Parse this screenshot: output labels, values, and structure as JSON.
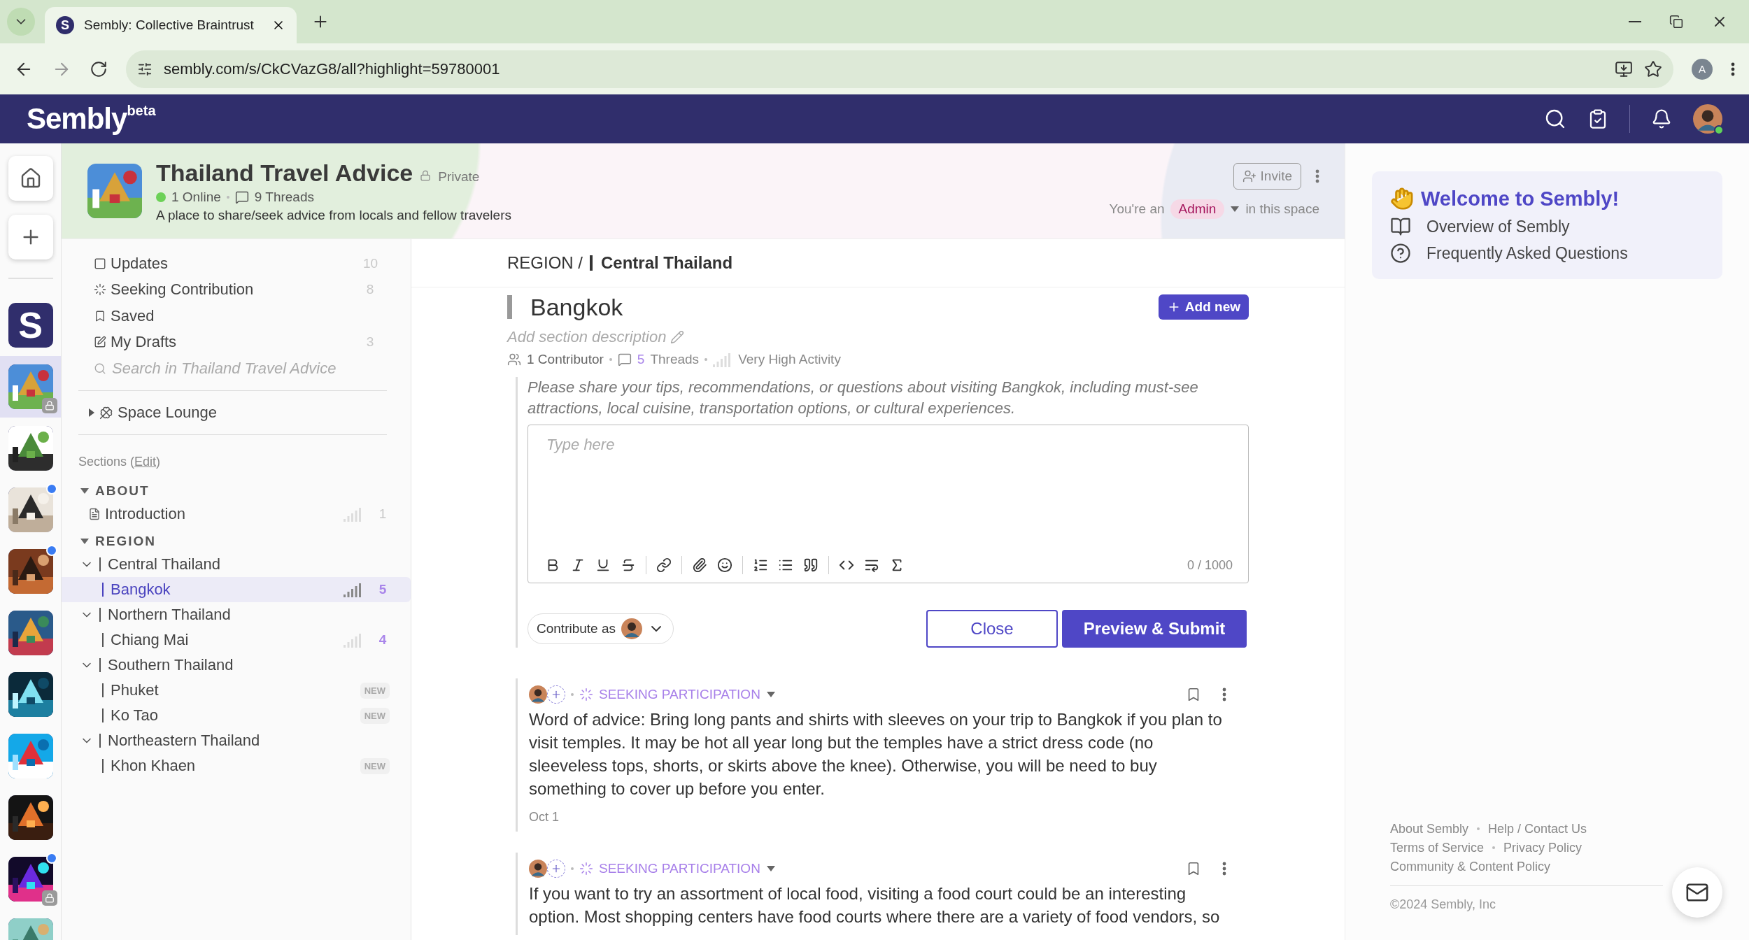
{
  "browser": {
    "tab_title": "Sembly: Collective Braintrust",
    "favicon": "S",
    "url": "sembly.com/s/CkCVazG8/all?highlight=59780001",
    "profile_initial": "A"
  },
  "app_header": {
    "logo": "Sembly",
    "logo_badge": "beta"
  },
  "rail": [
    {
      "kind": "letter",
      "label": "S",
      "selected": false,
      "unread": false,
      "locked": false
    },
    {
      "kind": "picture",
      "selected": true,
      "unread": false,
      "locked": true
    },
    {
      "kind": "picture",
      "selected": false,
      "unread": false,
      "locked": false
    },
    {
      "kind": "picture",
      "selected": false,
      "unread": true,
      "locked": false
    },
    {
      "kind": "picture",
      "selected": false,
      "unread": true,
      "locked": false
    },
    {
      "kind": "picture",
      "selected": false,
      "unread": false,
      "locked": false
    },
    {
      "kind": "picture",
      "selected": false,
      "unread": false,
      "locked": false
    },
    {
      "kind": "picture",
      "selected": false,
      "unread": false,
      "locked": false
    },
    {
      "kind": "picture",
      "selected": false,
      "unread": false,
      "locked": false
    },
    {
      "kind": "picture",
      "selected": false,
      "unread": true,
      "locked": true
    },
    {
      "kind": "picture",
      "selected": false,
      "unread": false,
      "locked": false
    }
  ],
  "space": {
    "title": "Thailand Travel Advice",
    "privacy": "Private",
    "online": "1 Online",
    "threads": "9 Threads",
    "description": "A place to share/seek advice from locals and fellow travelers",
    "invite": "Invite",
    "role_prefix": "You're an",
    "role": "Admin",
    "role_suffix": "in this space"
  },
  "nav": [
    {
      "kind": "updates",
      "label": "Updates",
      "count": "10"
    },
    {
      "kind": "seeking",
      "label": "Seeking Contribution",
      "count": "8"
    },
    {
      "kind": "saved",
      "label": "Saved"
    },
    {
      "kind": "drafts",
      "label": "My Drafts",
      "count": "3"
    }
  ],
  "search": {
    "placeholder": "Search in Thailand Travel Advice"
  },
  "lounge": {
    "label": "Space Lounge",
    "expanded": false
  },
  "sections_heading": {
    "prefix": "Sections (",
    "edit": "Edit",
    "suffix": ")"
  },
  "sections": [
    {
      "title": "ABOUT",
      "expanded": true,
      "items": [
        {
          "kind": "page",
          "label": "Introduction",
          "count": "1",
          "unread": false,
          "selected": false
        }
      ]
    },
    {
      "title": "REGION",
      "expanded": true,
      "items": [
        {
          "kind": "group",
          "label": "Central Thailand",
          "expanded": true,
          "children": [
            {
              "kind": "section",
              "label": "Bangkok",
              "count": "5",
              "unread": true,
              "selected": true
            }
          ]
        },
        {
          "kind": "group",
          "label": "Northern Thailand",
          "expanded": true,
          "children": [
            {
              "kind": "section",
              "label": "Chiang Mai",
              "count": "4",
              "unread": true,
              "selected": false
            }
          ]
        },
        {
          "kind": "group",
          "label": "Southern Thailand",
          "expanded": true,
          "children": [
            {
              "kind": "section",
              "label": "Phuket",
              "badge": "NEW",
              "selected": false
            },
            {
              "kind": "section",
              "label": "Ko Tao",
              "badge": "NEW",
              "selected": false
            }
          ]
        },
        {
          "kind": "group",
          "label": "Northeastern Thailand",
          "expanded": true,
          "children": [
            {
              "kind": "section",
              "label": "Khon Khaen",
              "badge": "NEW",
              "selected": false
            }
          ]
        }
      ]
    }
  ],
  "breadcrumb": {
    "parent": "REGION /",
    "current": "Central Thailand"
  },
  "section": {
    "title": "Bangkok",
    "add_new": "Add new",
    "description_placeholder": "Add section description",
    "contributors": "1 Contributor",
    "threads_count": "5",
    "threads_label": "Threads",
    "activity": "Very High Activity"
  },
  "composer": {
    "prompt": "Please share your tips, recommendations, or questions about visiting Bangkok, including must-see attractions, local cuisine, transportation options, or cultural experiences.",
    "placeholder": "Type here",
    "counter": "0 / 1000",
    "tool_groups": [
      [
        {
          "kind": "bold"
        },
        {
          "kind": "italic"
        },
        {
          "kind": "underline"
        },
        {
          "kind": "strike"
        }
      ],
      [
        {
          "kind": "link"
        }
      ],
      [
        {
          "kind": "attach"
        },
        {
          "kind": "emoji"
        }
      ],
      [
        {
          "kind": "ordered"
        },
        {
          "kind": "bullets"
        },
        {
          "kind": "quote"
        }
      ],
      [
        {
          "kind": "code"
        },
        {
          "kind": "wrap"
        },
        {
          "kind": "formula"
        }
      ]
    ],
    "contribute_as": "Contribute as",
    "close": "Close",
    "submit": "Preview & Submit"
  },
  "posts": [
    {
      "status": "SEEKING PARTICIPATION",
      "body": "Word of advice: Bring long pants and shirts with sleeves on your trip to Bangkok if you plan to visit temples. It may be hot all year long but the temples have a strict dress code (no sleeveless tops, shorts, or skirts above the knee). Otherwise, you will be need to buy something to cover up before you enter.",
      "date": "Oct 1"
    },
    {
      "status": "SEEKING PARTICIPATION",
      "body": "If you want to try an assortment of local food, visiting a food court could be an interesting option. Most shopping centers have food courts where there are a variety of food vendors, so"
    }
  ],
  "welcome": {
    "title": "Welcome to Sembly!",
    "links": [
      {
        "kind": "book",
        "label": "Overview of Sembly"
      },
      {
        "kind": "question",
        "label": "Frequently Asked Questions"
      }
    ]
  },
  "footer": {
    "rows": [
      [
        "About Sembly",
        "Help / Contact Us"
      ],
      [
        "Terms of Service",
        "Privacy Policy"
      ],
      [
        "Community & Content Policy"
      ]
    ],
    "copyright": "©2024 Sembly, Inc"
  }
}
